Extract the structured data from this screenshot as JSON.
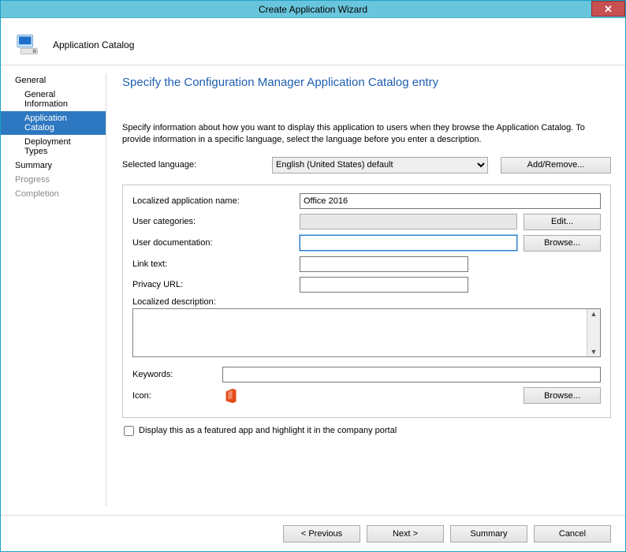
{
  "window": {
    "title": "Create Application Wizard"
  },
  "header": {
    "label": "Application Catalog"
  },
  "sidebar": {
    "items": [
      {
        "label": "General",
        "kind": "group"
      },
      {
        "label": "General Information",
        "kind": "sub"
      },
      {
        "label": "Application Catalog",
        "kind": "sub",
        "active": true
      },
      {
        "label": "Deployment Types",
        "kind": "sub"
      },
      {
        "label": "Summary",
        "kind": "group"
      },
      {
        "label": "Progress",
        "kind": "group",
        "disabled": true
      },
      {
        "label": "Completion",
        "kind": "group",
        "disabled": true
      }
    ]
  },
  "main": {
    "title": "Specify the Configuration Manager Application Catalog entry",
    "intro": "Specify information about how you want to display this application to users when they browse the Application Catalog. To provide information in a specific language, select the language before you enter a description.",
    "selectedLanguageLabel": "Selected language:",
    "selectedLanguageValue": "English (United States) default",
    "addRemove": "Add/Remove...",
    "fields": {
      "appNameLabel": "Localized application name:",
      "appNameValue": "Office 2016",
      "userCatLabel": "User categories:",
      "userCatValue": "",
      "editBtn": "Edit...",
      "userDocLabel": "User documentation:",
      "userDocValue": "",
      "browseBtn": "Browse...",
      "linkTextLabel": "Link text:",
      "linkTextValue": "",
      "privacyLabel": "Privacy URL:",
      "privacyValue": "",
      "descLabel": "Localized description:",
      "descValue": "",
      "keywordsLabel": "Keywords:",
      "keywordsValue": "",
      "iconLabel": "Icon:",
      "browseIconBtn": "Browse..."
    },
    "featured": "Display this as a featured app and highlight it in the company portal"
  },
  "footer": {
    "previous": "< Previous",
    "next": "Next >",
    "summary": "Summary",
    "cancel": "Cancel"
  }
}
